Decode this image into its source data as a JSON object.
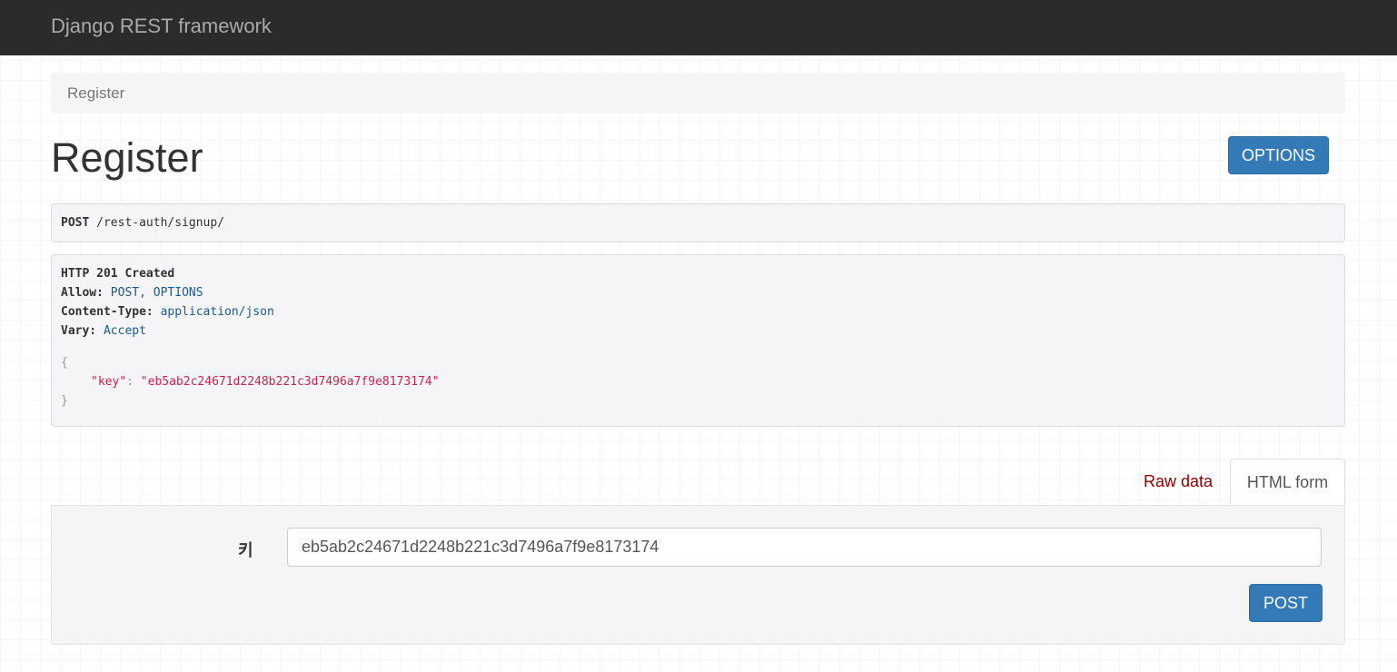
{
  "navbar": {
    "brand": "Django REST framework"
  },
  "breadcrumb": {
    "current": "Register"
  },
  "page": {
    "title": "Register",
    "options_button": "OPTIONS"
  },
  "request": {
    "method": "POST",
    "url": "/rest-auth/signup/"
  },
  "response": {
    "status": "HTTP 201 Created",
    "headers": [
      {
        "name": "Allow:",
        "value": "POST, OPTIONS"
      },
      {
        "name": "Content-Type:",
        "value": "application/json"
      },
      {
        "name": "Vary:",
        "value": "Accept"
      }
    ],
    "body": {
      "open": "{",
      "key": "\"key\"",
      "sep": ": ",
      "value": "\"eb5ab2c24671d2248b221c3d7496a7f9e8173174\"",
      "close": "}"
    }
  },
  "tabs": [
    {
      "label": "Raw data",
      "active": false
    },
    {
      "label": "HTML form",
      "active": true
    }
  ],
  "form": {
    "field_label": "키",
    "field_value": "eb5ab2c24671d2248b221c3d7496a7f9e8173174",
    "submit_label": "POST"
  },
  "colors": {
    "navbar": "#2b2b2b",
    "primary": "#337ab7",
    "header_value": "#1d5a8e",
    "json_string": "#c7254e",
    "raw_tab": "#8b0000"
  }
}
